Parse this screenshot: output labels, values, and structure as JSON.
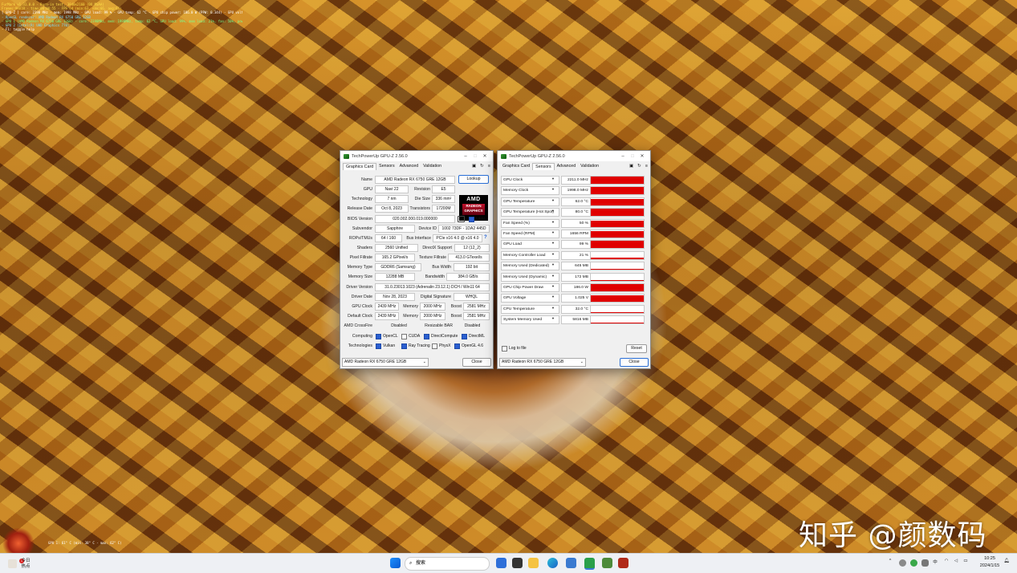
{
  "overlay": {
    "lines": [
      "FurMark v1.31.0.0 - Burn-in test, 3840x2160 (0X MSAA)",
      "Frames:98818 - time:00:00:55 - FPS:64 (min:63, max:66, avg:64)",
      "[ GPU-Z ] core: 2398 MHz - mem: 1998 MHz - GPU load: 99 % - GPU temp: 62 °C - GPU chip power: 186.0 W (PPW: 0.344) - GPU voltage: 1.025 V",
      "- OpenGL renderer: AMD Radeon RX 6750 GRE 12GB",
      "- GPU 1 (AMD Radeon RX 6750 GRE 12GB) - core: 2398MHz, mem: 1998MHz, temp: 62 °C, GPU load: 99%, mem load: 21%, fan: 50%, power: 186.0W (PPW: 0.344), fan: 49%",
      "- GPU 2 (Intel(R) UHD Graphics 770)",
      "- F1: toggle help"
    ],
    "bottom": "GPU 1: 61° C (min: 38° C - max: 62° C)"
  },
  "watermark": "知乎 @颜数码",
  "gpuz_main": {
    "title": "TechPowerUp GPU-Z 2.56.0",
    "tabs": [
      "Graphics Card",
      "Sensors",
      "Advanced",
      "Validation"
    ],
    "lookup": "Lookup",
    "logo_line1": "AMD",
    "logo_line2": "RADEON GRAPHICS",
    "uefi": "UEFI",
    "help": "?",
    "fields": {
      "name": {
        "label": "Name",
        "value": "AMD Radeon RX 6750 GRE 12GB"
      },
      "gpu": {
        "label": "GPU",
        "value": "Navi 22"
      },
      "revision": {
        "label": "Revision",
        "value": "E5"
      },
      "technology": {
        "label": "Technology",
        "value": "7 nm"
      },
      "die_size": {
        "label": "Die Size",
        "value": "336 mm²"
      },
      "release_date": {
        "label": "Release Date",
        "value": "Oct 8, 2023"
      },
      "transistors": {
        "label": "Transistors",
        "value": "17200M"
      },
      "bios_version": {
        "label": "BIOS Version",
        "value": "020.002.000.019.000000"
      },
      "subvendor": {
        "label": "Subvendor",
        "value": "Sapphire"
      },
      "device_id": {
        "label": "Device ID",
        "value": "1002 73DF - 1DA2 445D"
      },
      "rops_tmus": {
        "label": "ROPs/TMUs",
        "value": "64 / 160"
      },
      "bus_interface": {
        "label": "Bus Interface",
        "value": "PCIe x16 4.0 @ x16 4.0"
      },
      "shaders": {
        "label": "Shaders",
        "value": "2560 Unified"
      },
      "directx": {
        "label": "DirectX Support",
        "value": "12 (12_2)"
      },
      "pixel_fillrate": {
        "label": "Pixel Fillrate",
        "value": "165.2 GPixel/s"
      },
      "texture_fillrate": {
        "label": "Texture Fillrate",
        "value": "413.0 GTexel/s"
      },
      "memory_type": {
        "label": "Memory Type",
        "value": "GDDR6 (Samsung)"
      },
      "bus_width": {
        "label": "Bus Width",
        "value": "192 bit"
      },
      "memory_size": {
        "label": "Memory Size",
        "value": "12288 MB"
      },
      "bandwidth": {
        "label": "Bandwidth",
        "value": "384.0 GB/s"
      },
      "driver_version": {
        "label": "Driver Version",
        "value": "31.0.23013.1023 (Adrenalin 23.12.1) DCH / Win11 64"
      },
      "driver_date": {
        "label": "Driver Date",
        "value": "Nov 28, 2023"
      },
      "digital_signature": {
        "label": "Digital Signature",
        "value": "WHQL"
      },
      "gpu_clock": {
        "label": "GPU Clock",
        "value": "2439 MHz"
      },
      "gpu_memory": {
        "label": "Memory",
        "value": "2000 MHz"
      },
      "gpu_boost": {
        "label": "Boost",
        "value": "2581 MHz"
      },
      "default_clock": {
        "label": "Default Clock",
        "value": "2439 MHz"
      },
      "default_memory": {
        "label": "Memory",
        "value": "2000 MHz"
      },
      "default_boost": {
        "label": "Boost",
        "value": "2581 MHz"
      },
      "crossfire": {
        "label": "AMD CrossFire",
        "value": "Disabled"
      },
      "resizable_bar": {
        "label": "Resizable BAR",
        "value": "Disabled"
      }
    },
    "computing_label": "Computing",
    "computing": [
      {
        "name": "OpenCL",
        "checked": true
      },
      {
        "name": "CUDA",
        "checked": false
      },
      {
        "name": "DirectCompute",
        "checked": true
      },
      {
        "name": "DirectML",
        "checked": true
      }
    ],
    "technologies_label": "Technologies",
    "technologies": [
      {
        "name": "Vulkan",
        "checked": true
      },
      {
        "name": "Ray Tracing",
        "checked": true
      },
      {
        "name": "PhysX",
        "checked": false
      },
      {
        "name": "OpenGL 4.6",
        "checked": true
      }
    ],
    "selected_gpu": "AMD Radeon RX 6750 GRE 12GB",
    "close": "Close"
  },
  "gpuz_sensors": {
    "title": "TechPowerUp GPU-Z 2.56.0",
    "tabs": [
      "Graphics Card",
      "Sensors",
      "Advanced",
      "Validation"
    ],
    "sensors": [
      {
        "name": "GPU Clock",
        "value": "2211.0 MHz",
        "level": 0.95
      },
      {
        "name": "Memory Clock",
        "value": "1998.0 MHz",
        "level": 0.95
      },
      {
        "name": "GPU Temperature",
        "value": "62.0 °C",
        "level": 0.9
      },
      {
        "name": "GPU Temperature (Hot Spot)",
        "value": "80.0 °C",
        "level": 0.95
      },
      {
        "name": "Fan Speed (%)",
        "value": "50 %",
        "level": 0.85
      },
      {
        "name": "Fan Speed (RPM)",
        "value": "1656 RPM",
        "level": 0.85
      },
      {
        "name": "GPU Load",
        "value": "99 %",
        "level": 0.99
      },
      {
        "name": "Memory Controller Load",
        "value": "21 %",
        "level": 0.22
      },
      {
        "name": "Memory Used (Dedicated)",
        "value": "645 MB",
        "level": 0.08
      },
      {
        "name": "Memory Used (Dynamic)",
        "value": "172 MB",
        "level": 0.04
      },
      {
        "name": "GPU Chip Power Draw",
        "value": "186.0 W",
        "level": 0.95
      },
      {
        "name": "GPU Voltage",
        "value": "1.025 V",
        "level": 0.85
      },
      {
        "name": "CPU Temperature",
        "value": "32.0 °C",
        "level": 0.12
      },
      {
        "name": "System Memory Used",
        "value": "5816 MB",
        "level": 0.12
      }
    ],
    "log_to_file": "Log to file",
    "reset": "Reset",
    "selected_gpu": "AMD Radeon RX 6750 GRE 12GB",
    "close": "Close"
  },
  "taskbar": {
    "news_line1": "今日",
    "news_line2": "热点",
    "news_badge": "1",
    "search_placeholder": "搜索",
    "tray_chevron": "^",
    "ime": "中",
    "time": "10:25",
    "date": "2024/1/15"
  },
  "colors": {
    "graph_red": "#e00000",
    "checkbox_blue": "#2b5fd0",
    "link_blue": "#1a5fd8"
  }
}
